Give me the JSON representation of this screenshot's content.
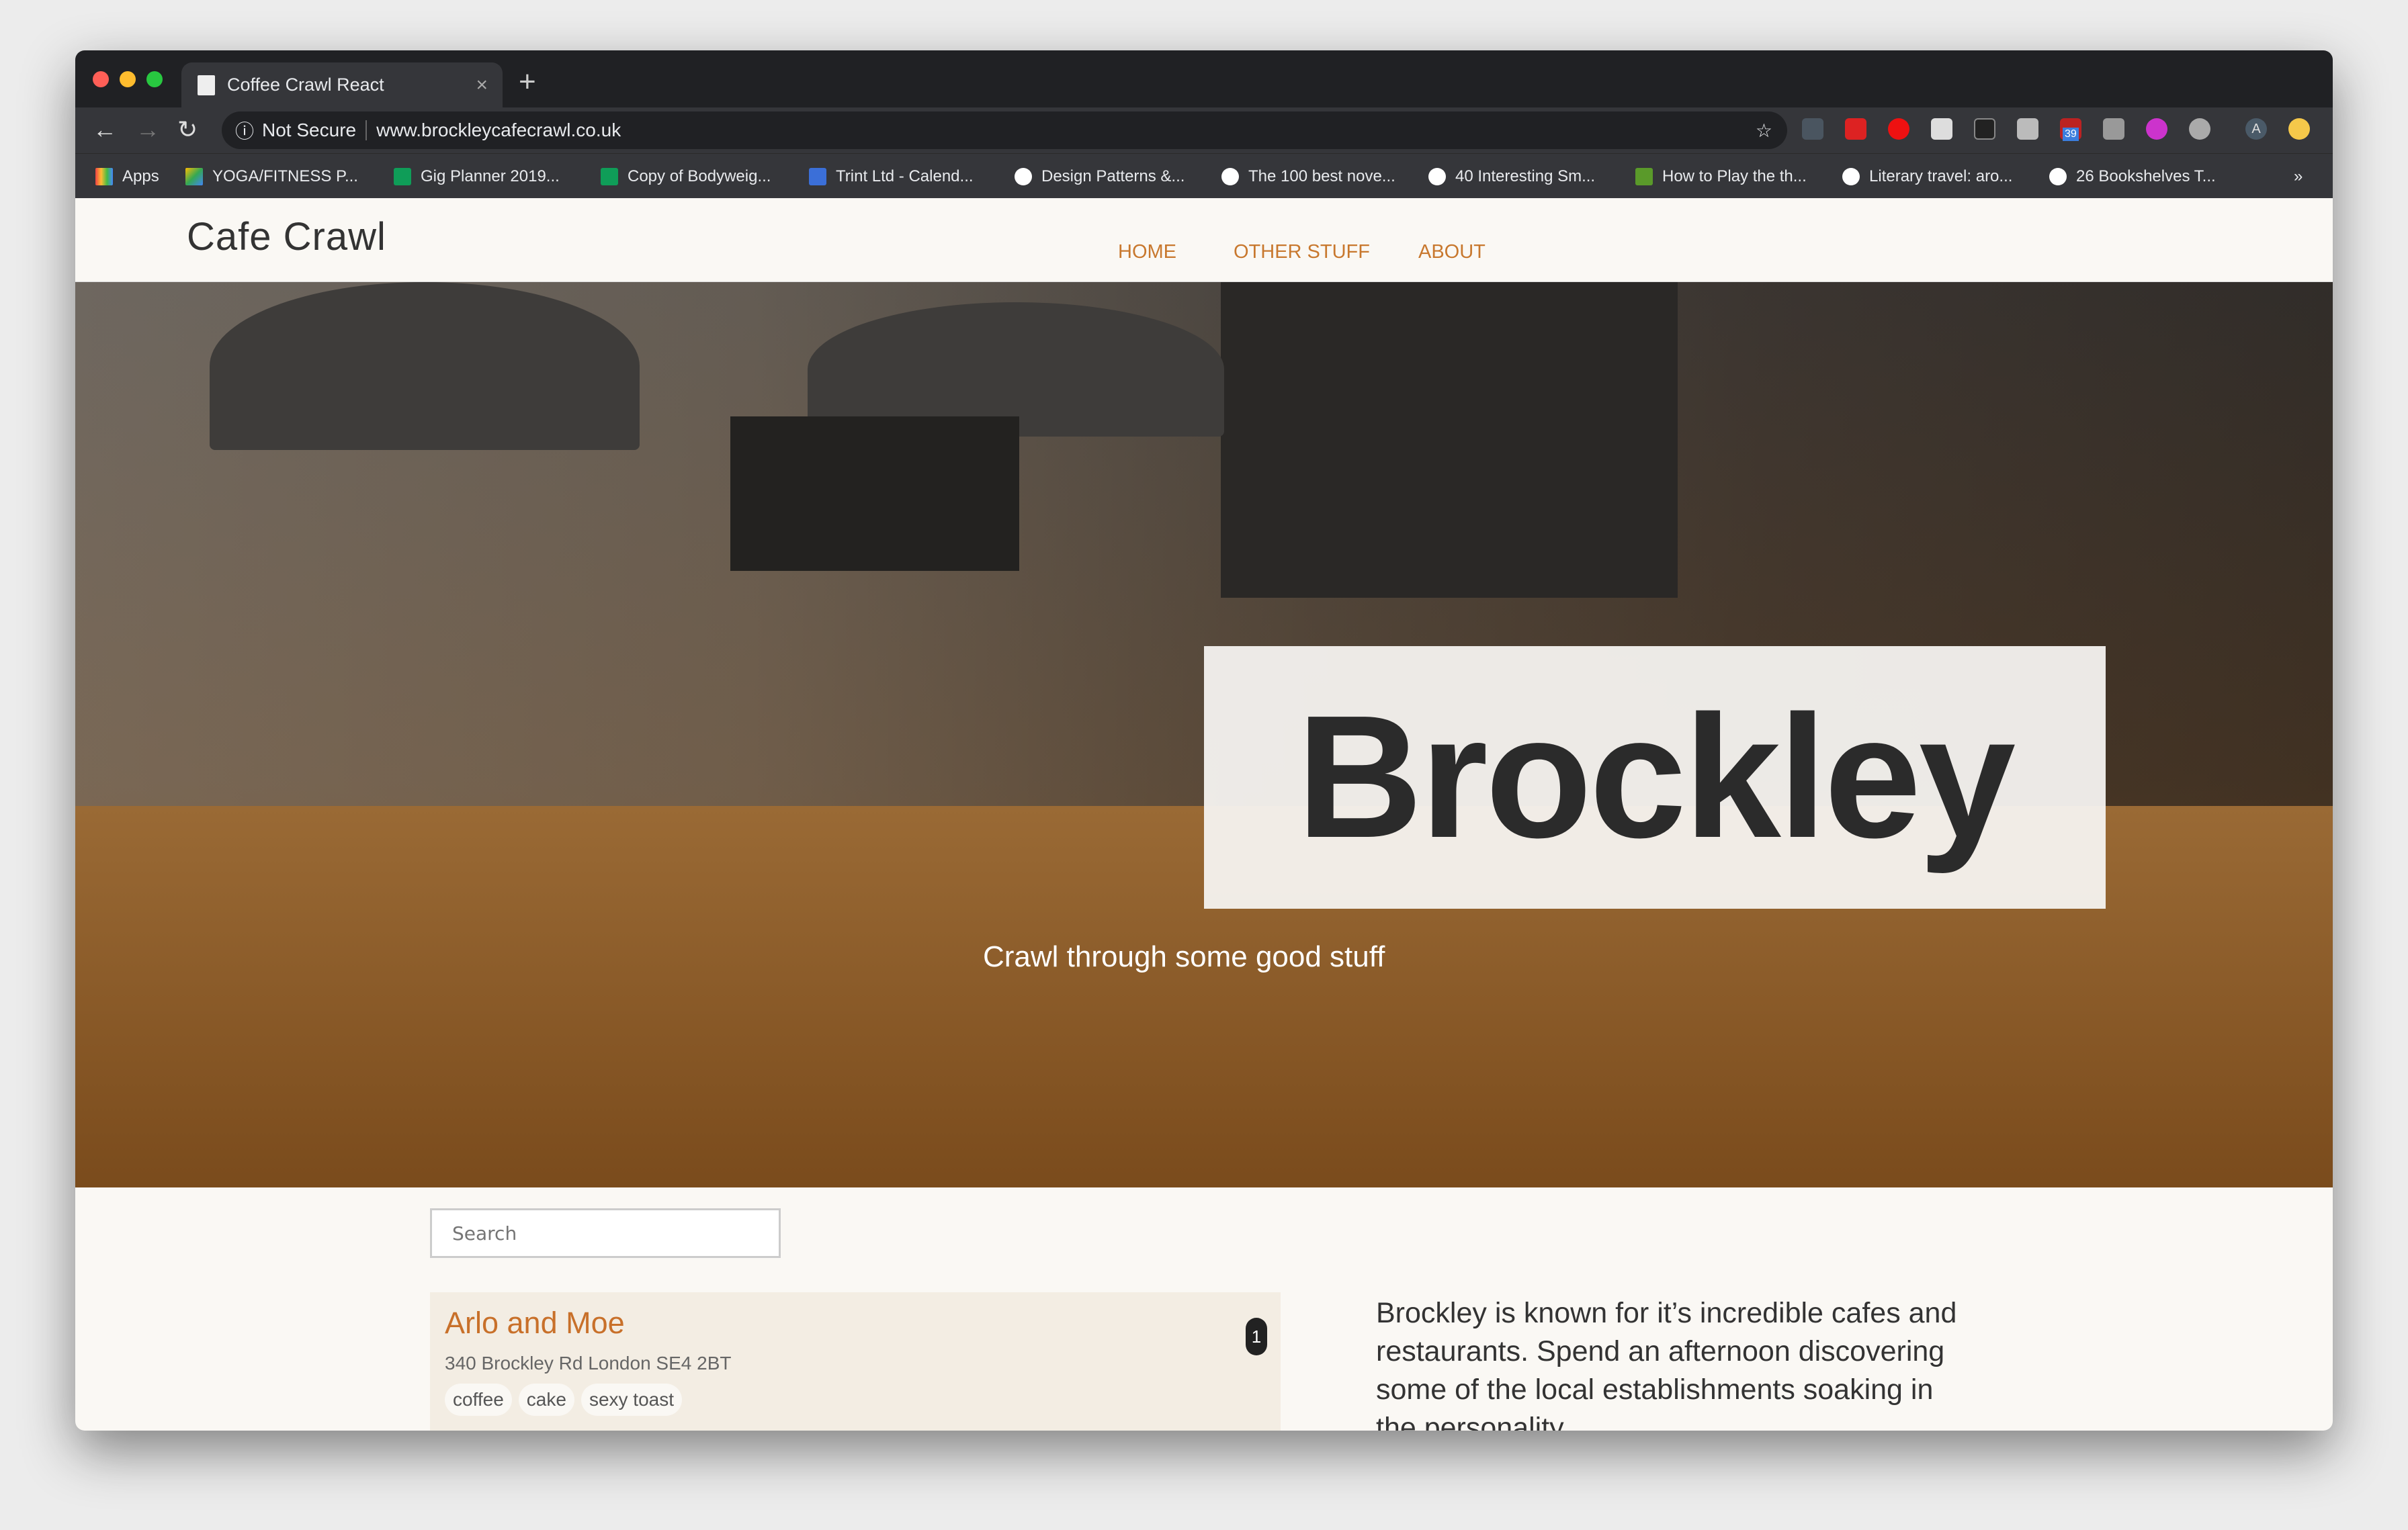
{
  "browser": {
    "tab_title": "Coffee Crawl React",
    "security": "Not Secure",
    "url": "www.brockleycafecrawl.co.uk",
    "extension_badge": "39",
    "profile_initial": "A",
    "bookmarks": [
      "Apps",
      "YOGA/FITNESS P...",
      "Gig Planner 2019...",
      "Copy of Bodyweig...",
      "Trint Ltd - Calend...",
      "Design Patterns &...",
      "The 100 best nove...",
      "40 Interesting Sm...",
      "How to Play the th...",
      "Literary travel: aro...",
      "26 Bookshelves T..."
    ],
    "more": "»"
  },
  "site": {
    "logo": "Cafe Crawl",
    "nav": [
      "HOME",
      "OTHER STUFF",
      "ABOUT"
    ],
    "accent": "#c8782e"
  },
  "hero": {
    "title": "Brockley",
    "tagline": "Crawl through some good stuff"
  },
  "search": {
    "placeholder": "Search"
  },
  "cafes": [
    {
      "name": "Arlo and Moe",
      "address": "340 Brockley Rd London SE4 2BT",
      "tags": [
        "coffee",
        "cake",
        "sexy toast"
      ],
      "number": "1"
    }
  ],
  "description": "Brockley is known for it’s incredible cafes and restaurants. Spend an afternoon discovering some of the local establishments soaking in the personality"
}
